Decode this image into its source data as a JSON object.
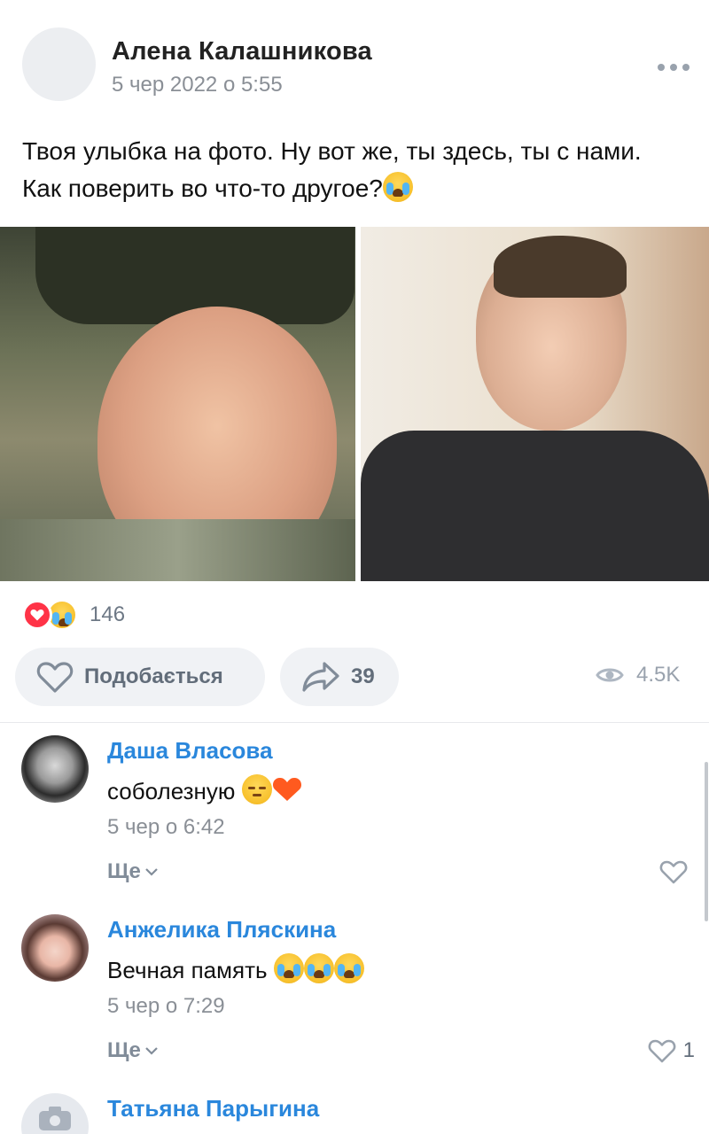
{
  "post": {
    "author": "Алена Калашникова",
    "date": "5 чер 2022 о 5:55",
    "text": "Твоя улыбка на фото. Ну вот же, ты здесь, ты с нами. Как поверить во что-то другое?",
    "text_emoji": "loudly-crying-face"
  },
  "reactions": {
    "icons": [
      "red-heart",
      "crying-face"
    ],
    "count": "146"
  },
  "actions": {
    "like_label": "Подобається",
    "share_count": "39",
    "views_count": "4.5K"
  },
  "comments": [
    {
      "name": "Даша Власова",
      "text": "соболезную",
      "emojis": [
        "pensive-face",
        "orange-heart"
      ],
      "date": "5 чер о 6:42",
      "more_label": "Ще",
      "likes": ""
    },
    {
      "name": "Анжелика Пляскина",
      "text": "Вечная память",
      "emojis": [
        "loudly-crying-face",
        "loudly-crying-face",
        "loudly-crying-face"
      ],
      "date": "5 чер о 7:29",
      "more_label": "Ще",
      "likes": "1"
    },
    {
      "name": "Татьяна Парыгина",
      "text": "",
      "date": "",
      "more_label": "",
      "likes": ""
    }
  ],
  "colors": {
    "link": "#2a87dc",
    "muted": "#8a8f96",
    "button_bg": "#f0f2f5",
    "heart": "#ff3347"
  }
}
